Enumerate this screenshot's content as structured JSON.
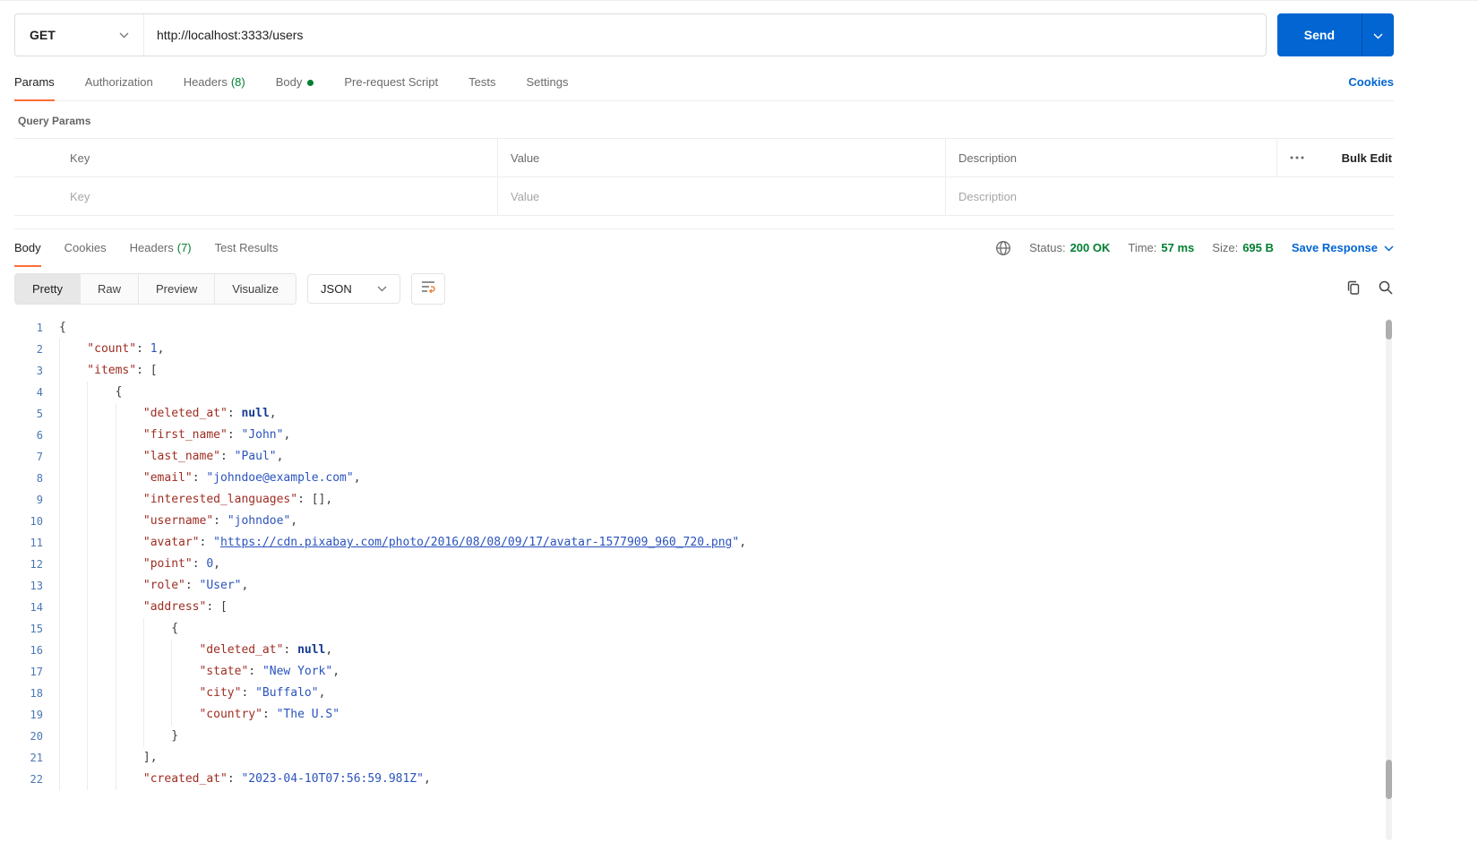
{
  "colors": {
    "accent_orange": "#ff6c37",
    "primary_blue": "#0265d2",
    "success_green": "#007f31"
  },
  "request": {
    "method": "GET",
    "url": "http://localhost:3333/users",
    "send_label": "Send",
    "cookies_link": "Cookies",
    "tabs": [
      {
        "label": "Params"
      },
      {
        "label": "Authorization"
      },
      {
        "label": "Headers",
        "count": "(8)"
      },
      {
        "label": "Body"
      },
      {
        "label": "Pre-request Script"
      },
      {
        "label": "Tests"
      },
      {
        "label": "Settings"
      }
    ],
    "query_params": {
      "section_label": "Query Params",
      "columns": {
        "key": "Key",
        "value": "Value",
        "description": "Description"
      },
      "bulk_edit_label": "Bulk Edit",
      "row_placeholders": {
        "key": "Key",
        "value": "Value",
        "description": "Description"
      }
    }
  },
  "response": {
    "tabs": [
      {
        "label": "Body"
      },
      {
        "label": "Cookies"
      },
      {
        "label": "Headers",
        "count": "(7)"
      },
      {
        "label": "Test Results"
      }
    ],
    "meta": {
      "status_label": "Status:",
      "status_value": "200 OK",
      "time_label": "Time:",
      "time_value": "57 ms",
      "size_label": "Size:",
      "size_value": "695 B",
      "save_response_label": "Save Response"
    },
    "view_tabs": {
      "pretty": "Pretty",
      "raw": "Raw",
      "preview": "Preview",
      "visualize": "Visualize"
    },
    "format": "JSON"
  },
  "code": {
    "lines": [
      {
        "n": 1,
        "i": 0,
        "t": [
          [
            "p",
            "{"
          ]
        ]
      },
      {
        "n": 2,
        "i": 1,
        "t": [
          [
            "k",
            "\"count\""
          ],
          [
            "p",
            ": "
          ],
          [
            "n",
            "1"
          ],
          [
            "p",
            ","
          ]
        ]
      },
      {
        "n": 3,
        "i": 1,
        "t": [
          [
            "k",
            "\"items\""
          ],
          [
            "p",
            ": ["
          ]
        ]
      },
      {
        "n": 4,
        "i": 2,
        "t": [
          [
            "p",
            "{"
          ]
        ]
      },
      {
        "n": 5,
        "i": 3,
        "t": [
          [
            "k",
            "\"deleted_at\""
          ],
          [
            "p",
            ": "
          ],
          [
            "u",
            "null"
          ],
          [
            "p",
            ","
          ]
        ]
      },
      {
        "n": 6,
        "i": 3,
        "t": [
          [
            "k",
            "\"first_name\""
          ],
          [
            "p",
            ": "
          ],
          [
            "s",
            "\"John\""
          ],
          [
            "p",
            ","
          ]
        ]
      },
      {
        "n": 7,
        "i": 3,
        "t": [
          [
            "k",
            "\"last_name\""
          ],
          [
            "p",
            ": "
          ],
          [
            "s",
            "\"Paul\""
          ],
          [
            "p",
            ","
          ]
        ]
      },
      {
        "n": 8,
        "i": 3,
        "t": [
          [
            "k",
            "\"email\""
          ],
          [
            "p",
            ": "
          ],
          [
            "s",
            "\"johndoe@example.com\""
          ],
          [
            "p",
            ","
          ]
        ]
      },
      {
        "n": 9,
        "i": 3,
        "t": [
          [
            "k",
            "\"interested_languages\""
          ],
          [
            "p",
            ": [],"
          ]
        ]
      },
      {
        "n": 10,
        "i": 3,
        "t": [
          [
            "k",
            "\"username\""
          ],
          [
            "p",
            ": "
          ],
          [
            "s",
            "\"johndoe\""
          ],
          [
            "p",
            ","
          ]
        ]
      },
      {
        "n": 11,
        "i": 3,
        "t": [
          [
            "k",
            "\"avatar\""
          ],
          [
            "p",
            ": "
          ],
          [
            "s",
            "\""
          ],
          [
            "l",
            "https://cdn.pixabay.com/photo/2016/08/08/09/17/avatar-1577909_960_720.png"
          ],
          [
            "s",
            "\""
          ],
          [
            "p",
            ","
          ]
        ]
      },
      {
        "n": 12,
        "i": 3,
        "t": [
          [
            "k",
            "\"point\""
          ],
          [
            "p",
            ": "
          ],
          [
            "n",
            "0"
          ],
          [
            "p",
            ","
          ]
        ]
      },
      {
        "n": 13,
        "i": 3,
        "t": [
          [
            "k",
            "\"role\""
          ],
          [
            "p",
            ": "
          ],
          [
            "s",
            "\"User\""
          ],
          [
            "p",
            ","
          ]
        ]
      },
      {
        "n": 14,
        "i": 3,
        "t": [
          [
            "k",
            "\"address\""
          ],
          [
            "p",
            ": ["
          ]
        ]
      },
      {
        "n": 15,
        "i": 4,
        "t": [
          [
            "p",
            "{"
          ]
        ]
      },
      {
        "n": 16,
        "i": 5,
        "t": [
          [
            "k",
            "\"deleted_at\""
          ],
          [
            "p",
            ": "
          ],
          [
            "u",
            "null"
          ],
          [
            "p",
            ","
          ]
        ]
      },
      {
        "n": 17,
        "i": 5,
        "t": [
          [
            "k",
            "\"state\""
          ],
          [
            "p",
            ": "
          ],
          [
            "s",
            "\"New York\""
          ],
          [
            "p",
            ","
          ]
        ]
      },
      {
        "n": 18,
        "i": 5,
        "t": [
          [
            "k",
            "\"city\""
          ],
          [
            "p",
            ": "
          ],
          [
            "s",
            "\"Buffalo\""
          ],
          [
            "p",
            ","
          ]
        ]
      },
      {
        "n": 19,
        "i": 5,
        "t": [
          [
            "k",
            "\"country\""
          ],
          [
            "p",
            ": "
          ],
          [
            "s",
            "\"The U.S\""
          ]
        ]
      },
      {
        "n": 20,
        "i": 4,
        "t": [
          [
            "p",
            "}"
          ]
        ]
      },
      {
        "n": 21,
        "i": 3,
        "t": [
          [
            "p",
            "],"
          ]
        ]
      },
      {
        "n": 22,
        "i": 3,
        "t": [
          [
            "k",
            "\"created_at\""
          ],
          [
            "p",
            ": "
          ],
          [
            "s",
            "\"2023-04-10T07:56:59.981Z\""
          ],
          [
            "p",
            ","
          ]
        ]
      }
    ]
  }
}
